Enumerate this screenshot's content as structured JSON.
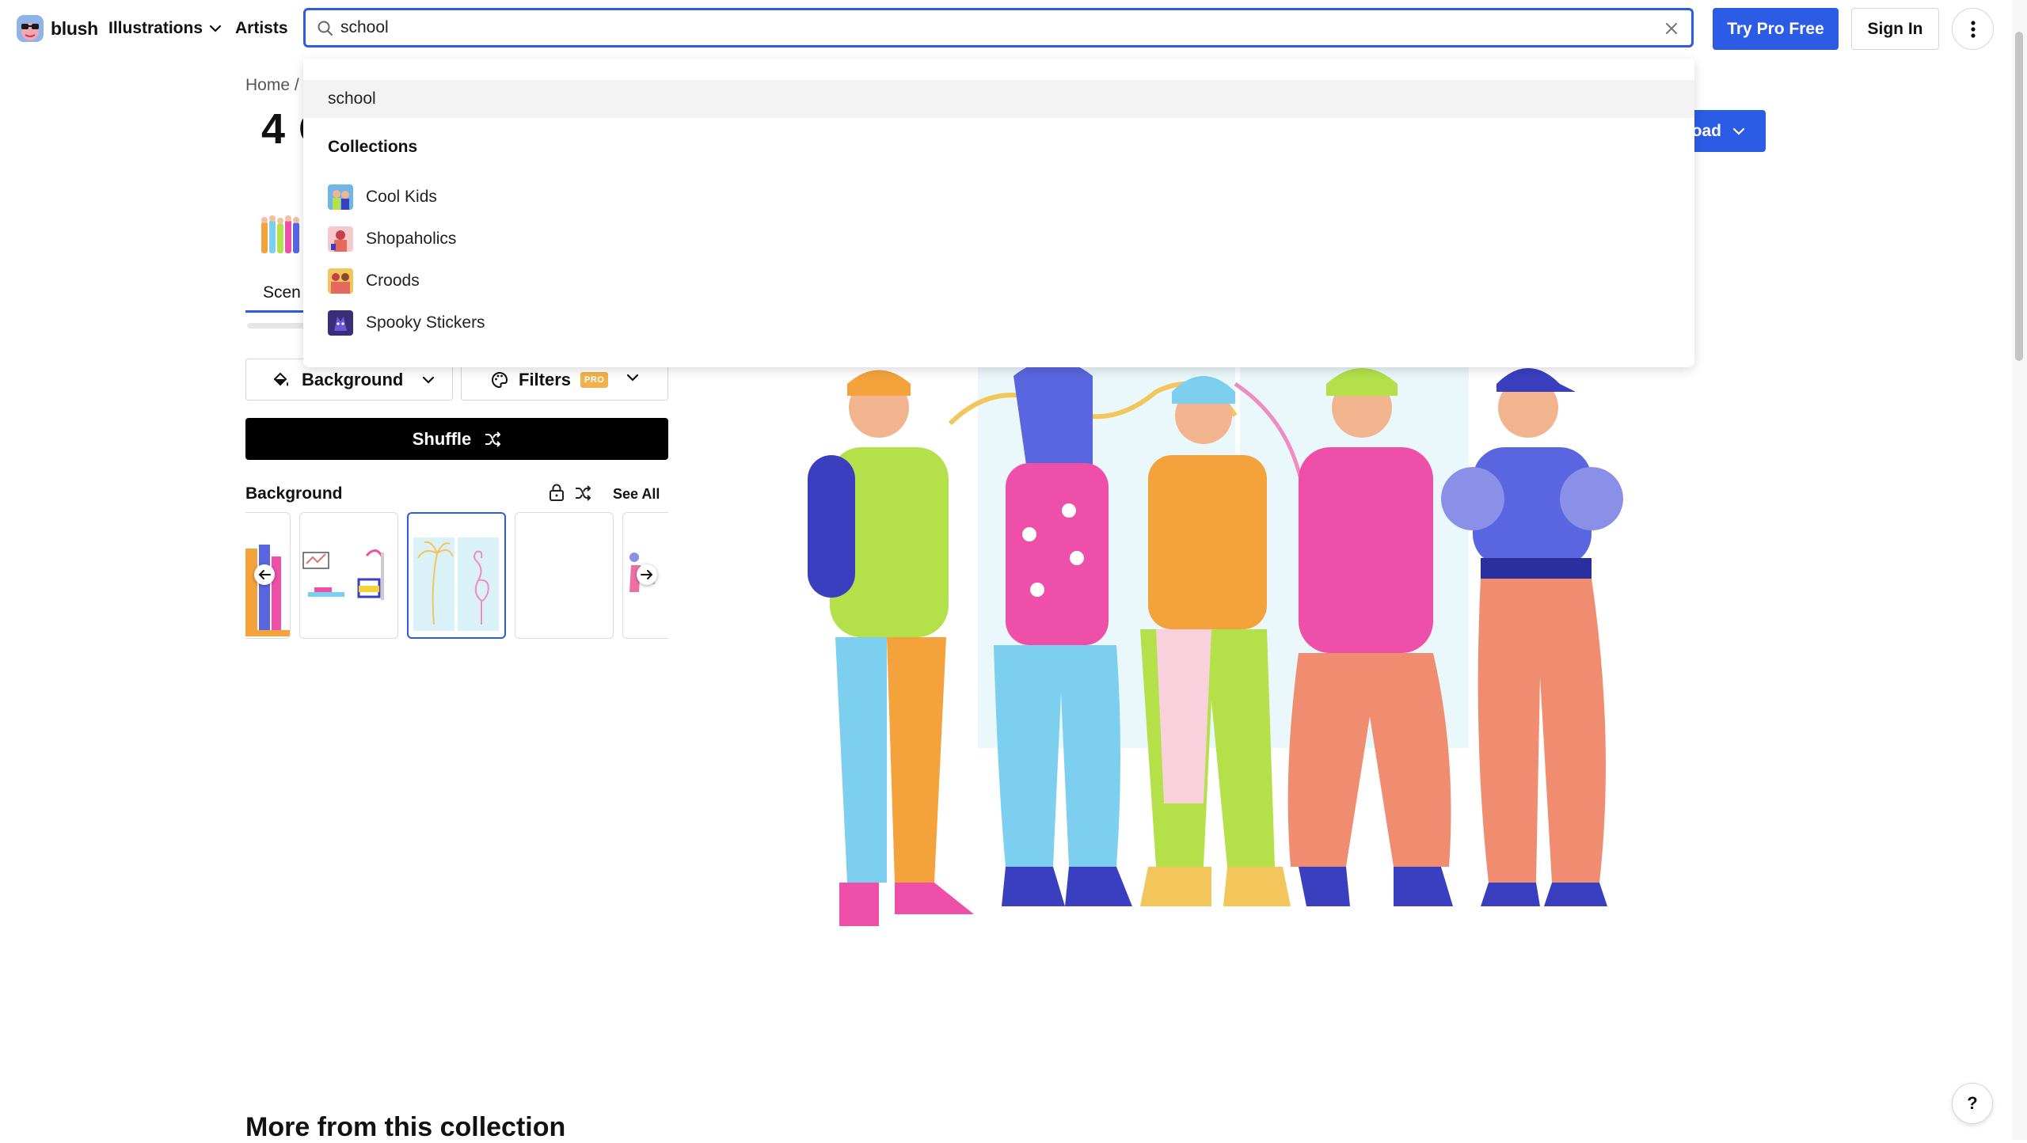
{
  "header": {
    "logo_text": "blush",
    "nav_illustrations": "Illustrations",
    "nav_artists": "Artists",
    "search_value": "school",
    "try_pro_label": "Try Pro Free",
    "sign_in_label": "Sign In"
  },
  "page": {
    "breadcrumb": "Home /",
    "title_partial": "4 C",
    "download_label": "oad",
    "tab_scenes": "Scen"
  },
  "controls": {
    "background_dropdown": "Background",
    "filters_dropdown": "Filters",
    "pro_badge": "PRO",
    "shuffle_label": "Shuffle",
    "section_label": "Background",
    "see_all": "See All"
  },
  "suggestions": {
    "query": "school",
    "collections_heading": "Collections",
    "items": [
      {
        "label": "Cool Kids"
      },
      {
        "label": "Shopaholics"
      },
      {
        "label": "Croods"
      },
      {
        "label": "Spooky Stickers"
      }
    ]
  },
  "footer": {
    "more_heading": "More from this collection",
    "help_label": "?"
  },
  "colors": {
    "accent": "#2c5ce6",
    "pro_badge": "#f1b24c"
  }
}
